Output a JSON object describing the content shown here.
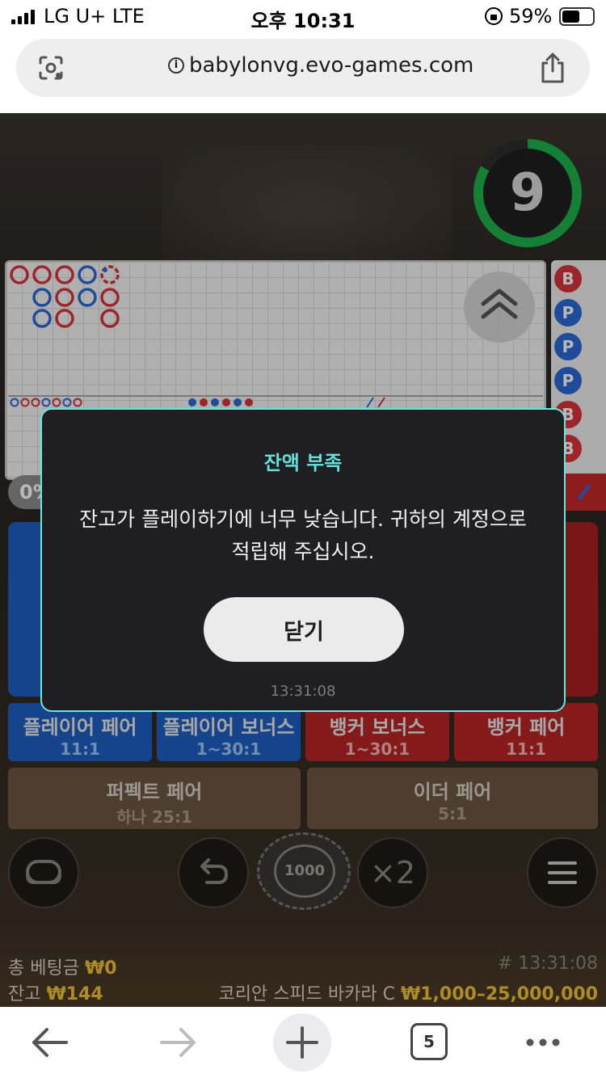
{
  "status_bar": {
    "carrier": "LG U+   LTE",
    "time": "오후 10:31",
    "battery": "59%",
    "battery_level": 0.59
  },
  "browser": {
    "url": "babylonvg.evo-games.com"
  },
  "game": {
    "timer": "9",
    "stat_pct": "0%",
    "bead_road": [
      "B",
      "P",
      "P",
      "P",
      "B",
      "B"
    ],
    "bets": {
      "player_pair": {
        "label": "플레이어 페어",
        "odds": "11:1"
      },
      "player_bonus": {
        "label": "플레이어 보너스",
        "odds": "1~30:1"
      },
      "banker_bonus": {
        "label": "뱅커 보너스",
        "odds": "1~30:1"
      },
      "banker_pair": {
        "label": "뱅커 페어",
        "odds": "11:1"
      },
      "perfect_pair": {
        "label": "퍼펙트 페어",
        "odds": "하나 25:1"
      },
      "either_pair": {
        "label": "이더 페어",
        "odds": "5:1"
      }
    },
    "chip_value": "1000",
    "double_label": "×2",
    "footer": {
      "total_bet_label": "총 베팅금",
      "total_bet_value": "₩0",
      "balance_label": "잔고",
      "balance_value": "₩144",
      "round_id": "# 13:31:08",
      "table_name": "코리안 스피드 바카라 C",
      "limits": "₩1,000–25,000,000"
    }
  },
  "dialog": {
    "title": "잔액 부족",
    "message": "잔고가 플레이하기에 너무 낮습니다. 귀하의 계정으로 적립해 주십시오.",
    "close_label": "닫기",
    "timestamp": "13:31:08"
  },
  "toolbar": {
    "tab_count": "5"
  },
  "colors": {
    "accent": "#64e0da",
    "player": "#1f5fc2",
    "banker": "#c42828",
    "gold": "#f1c232",
    "timer": "#1db24c"
  }
}
